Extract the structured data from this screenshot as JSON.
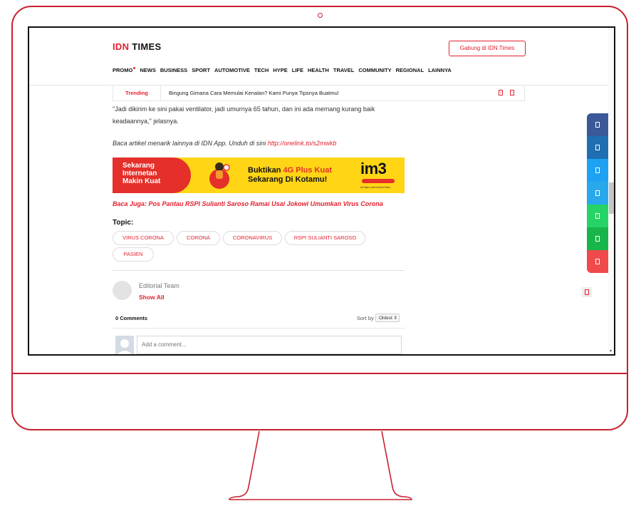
{
  "header": {
    "logo_idn": "IDN",
    "logo_times": "TIMES",
    "join_button": "Gabung di IDN Times",
    "nav": [
      "PROMO",
      "NEWS",
      "BUSINESS",
      "SPORT",
      "AUTOMOTIVE",
      "TECH",
      "HYPE",
      "LIFE",
      "HEALTH",
      "TRAVEL",
      "COMMUNITY",
      "REGIONAL",
      "LAINNYA"
    ]
  },
  "trending": {
    "label": "Trending",
    "text": "Bingung Gimana Cara Memulai Kenalan? Kami Punya Tipsnya Buatmu!"
  },
  "article": {
    "quote_line1": "\"Jadi dikirim ke sini pakai ventilator, jadi umurnya 65 tahun, dan ini ada memang kurang baik",
    "quote_line2": "keadaannya,\" jelasnya.",
    "app_prompt": "Baca artikel menarik lainnya di IDN App. Unduh di sini ",
    "app_link": "http://onelink.to/s2mwkb",
    "read_also": "Baca Juga: Pos Pantau RSPI Sulianti Saroso Ramai Usai Jokowi Umumkan Virus Corona"
  },
  "banner": {
    "left_line1": "Sekarang",
    "left_line2": "Internetan",
    "left_line3": "Makin Kuat",
    "center_prefix": "Buktikan ",
    "center_highlight": "4G Plus Kuat",
    "center_line2": "Sekarang  Di Kotamu!",
    "brand": "im3",
    "tagline": "Ini Baru Internetan Baru"
  },
  "topics": {
    "label": "Topic:",
    "tags": [
      "VIRUS CORONA",
      "CORONA",
      "CORONAVIRUS",
      "RSPI SULIANTI SAROSO",
      "PASIEN"
    ]
  },
  "author": {
    "name": "Editorial Team",
    "show_all": "Show All"
  },
  "comments": {
    "count": "0 Comments",
    "sort_label": "Sort by",
    "sort_value": "Oldest",
    "placeholder": "Add a comment..."
  },
  "social_colors": [
    "#3b5998",
    "#1f6fb2",
    "#1da1f2",
    "#29a9eb",
    "#25d366",
    "#18b64a",
    "#f04a4a"
  ],
  "colors": {
    "brand": "#e5202e",
    "frame": "#c8202f"
  }
}
